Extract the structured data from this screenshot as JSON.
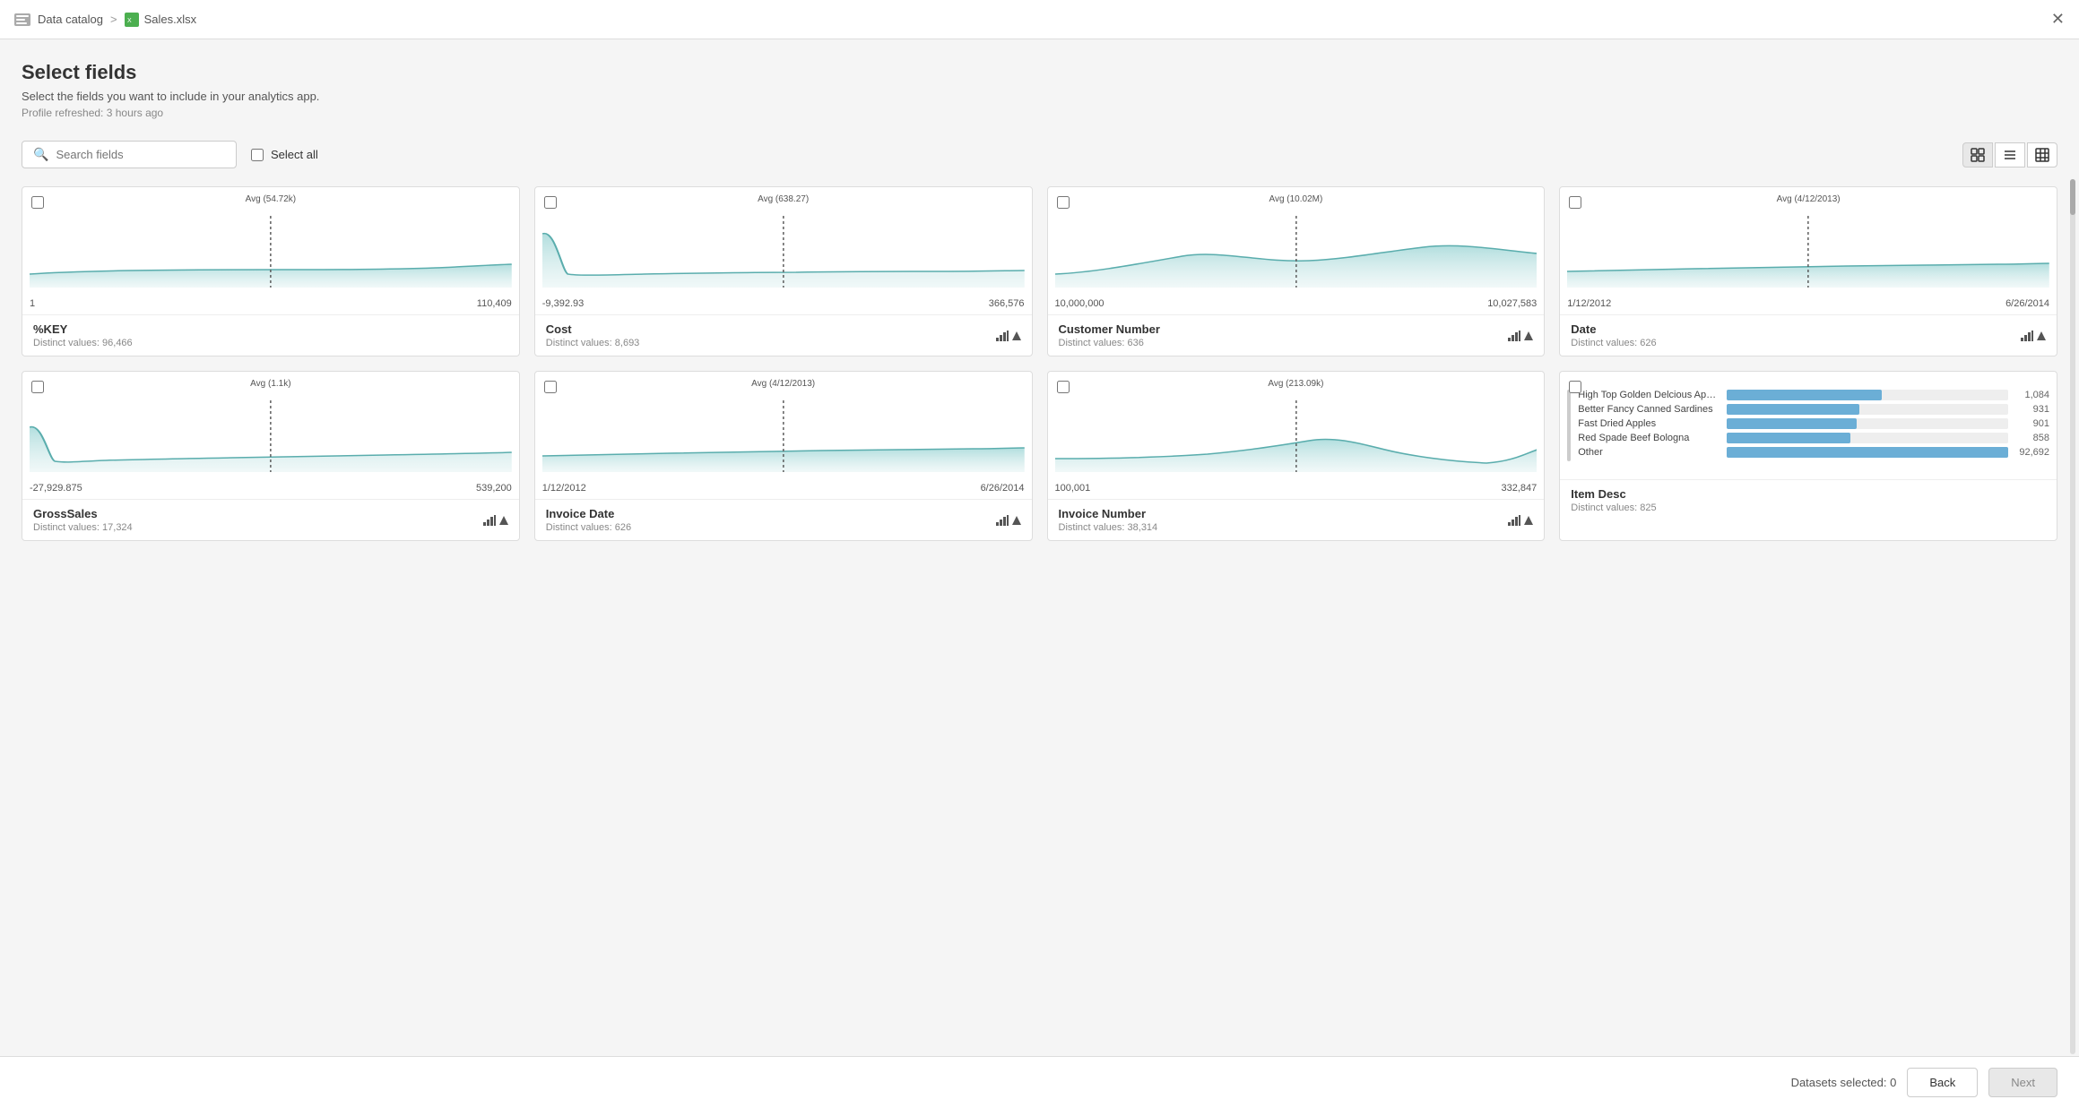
{
  "topbar": {
    "data_catalog": "Data catalog",
    "separator": ">",
    "filename": "Sales.xlsx"
  },
  "page": {
    "title": "Select fields",
    "subtitle": "Select the fields you want to include in your analytics app.",
    "profile_refresh": "Profile refreshed: 3 hours ago"
  },
  "toolbar": {
    "search_placeholder": "Search fields",
    "select_all_label": "Select all"
  },
  "view_modes": [
    "grid",
    "list",
    "table"
  ],
  "cards": [
    {
      "id": "pct_key",
      "name": "%KEY",
      "distinct": "Distinct values: 96,466",
      "avg_label": "Avg (54.72k)",
      "range_min": "1",
      "range_max": "110,409",
      "chart_type": "area",
      "has_toggle": false
    },
    {
      "id": "cost",
      "name": "Cost",
      "distinct": "Distinct values: 8,693",
      "avg_label": "Avg (638.27)",
      "range_min": "-9,392.93",
      "range_max": "366,576",
      "chart_type": "area",
      "has_toggle": true
    },
    {
      "id": "customer_number",
      "name": "Customer Number",
      "distinct": "Distinct values: 636",
      "avg_label": "Avg (10.02M)",
      "range_min": "10,000,000",
      "range_max": "10,027,583",
      "chart_type": "area",
      "has_toggle": true
    },
    {
      "id": "date",
      "name": "Date",
      "distinct": "Distinct values: 626",
      "avg_label": "Avg (4/12/2013)",
      "range_min": "1/12/2012",
      "range_max": "6/26/2014",
      "chart_type": "area",
      "has_toggle": true
    },
    {
      "id": "gross_sales",
      "name": "GrossSales",
      "distinct": "Distinct values: 17,324",
      "avg_label": "Avg (1.1k)",
      "range_min": "-27,929.875",
      "range_max": "539,200",
      "chart_type": "area",
      "has_toggle": true
    },
    {
      "id": "invoice_date",
      "name": "Invoice Date",
      "distinct": "Distinct values: 626",
      "avg_label": "Avg (4/12/2013)",
      "range_min": "1/12/2012",
      "range_max": "6/26/2014",
      "chart_type": "area",
      "has_toggle": true
    },
    {
      "id": "invoice_number",
      "name": "Invoice Number",
      "distinct": "Distinct values: 38,314",
      "avg_label": "Avg (213.09k)",
      "range_min": "100,001",
      "range_max": "332,847",
      "chart_type": "area",
      "has_toggle": true
    },
    {
      "id": "item_desc",
      "name": "Item Desc",
      "distinct": "Distinct values: 825",
      "chart_type": "bar",
      "has_toggle": false,
      "bar_items": [
        {
          "label": "High Top Golden Delcious Apples",
          "count": "1,084",
          "pct": 55
        },
        {
          "label": "Better Fancy Canned Sardines",
          "count": "931",
          "pct": 47
        },
        {
          "label": "Fast Dried Apples",
          "count": "901",
          "pct": 46
        },
        {
          "label": "Red Spade Beef Bologna",
          "count": "858",
          "pct": 44
        },
        {
          "label": "Other",
          "count": "92,692",
          "pct": 100
        }
      ]
    }
  ],
  "bottom_bar": {
    "datasets_label": "Datasets selected: 0",
    "back_label": "Back",
    "next_label": "Next"
  }
}
